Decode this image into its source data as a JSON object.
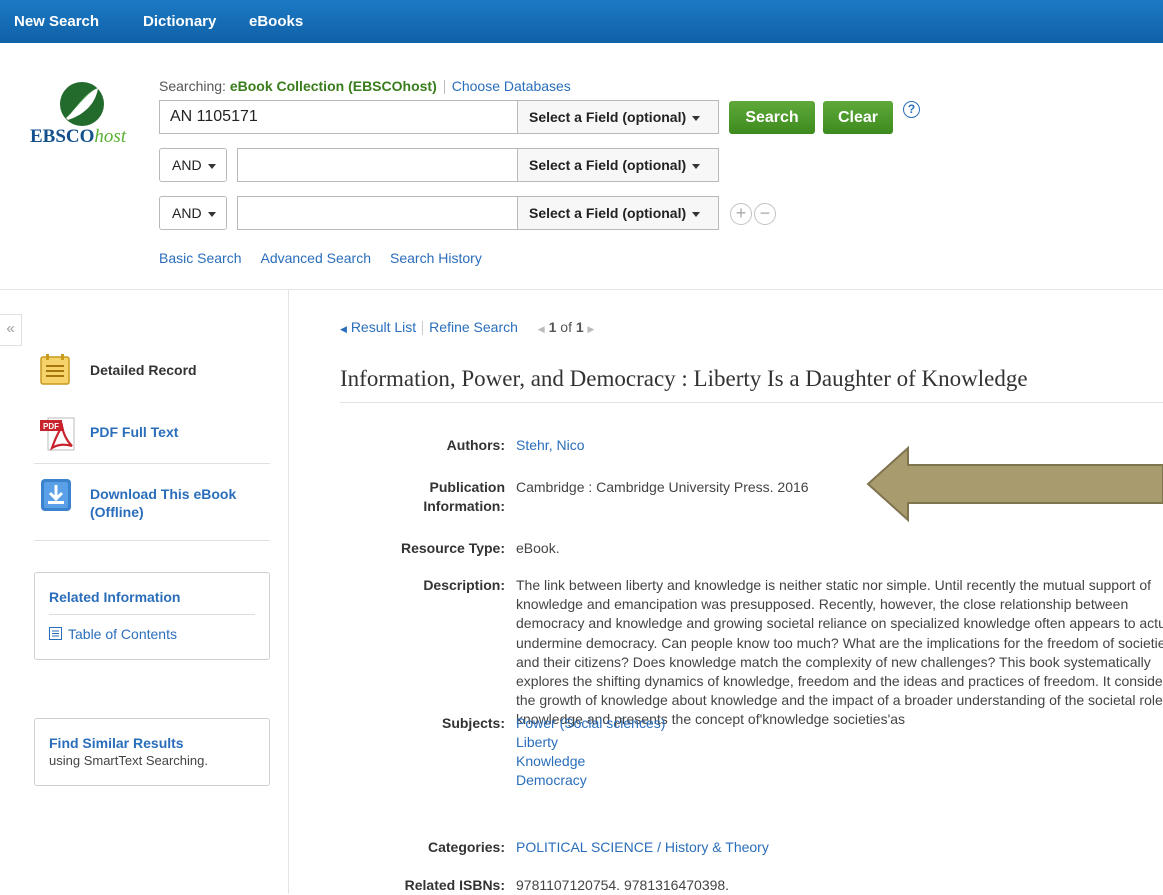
{
  "topnav": {
    "new_search": "New Search",
    "dictionary": "Dictionary",
    "ebooks": "eBooks"
  },
  "logo": {
    "brand": "EBSCO",
    "host": "host"
  },
  "searching": {
    "label": "Searching: ",
    "database": "eBook Collection (EBSCOhost)",
    "choose": "Choose Databases"
  },
  "search": {
    "row1_value": "AN 1105171",
    "field_label": "Select a Field (optional)",
    "bool_label": "AND",
    "search_button": "Search",
    "clear_button": "Clear",
    "help": "?",
    "plus": "+",
    "minus": "−"
  },
  "links": {
    "basic": "Basic Search",
    "advanced": "Advanced Search",
    "history": "Search History"
  },
  "sidebar": {
    "collapse": "«",
    "detailed": "Detailed Record",
    "pdf": "PDF Full Text",
    "pdf_badge": "PDF",
    "download": "Download This eBook (Offline)",
    "related_title": "Related Information",
    "toc": "Table of Contents",
    "similar_title": "Find Similar Results",
    "similar_sub": "using SmartText Searching."
  },
  "resultnav": {
    "result_list": "Result List",
    "refine": "Refine Search",
    "count_pre": "1",
    "count_mid": " of ",
    "count_post": "1"
  },
  "record": {
    "title": "Information, Power, and Democracy : Liberty Is a Daughter of Knowledge",
    "authors_label": "Authors:",
    "authors": "Stehr, Nico",
    "pub_label_1": "Publication",
    "pub_label_2": "Information:",
    "pub": "Cambridge : Cambridge University Press. 2016",
    "type_label": "Resource Type:",
    "type": "eBook.",
    "desc_label": "Description:",
    "desc": "The link between liberty and knowledge is neither static nor simple. Until recently the mutual support of knowledge and emancipation was presupposed. Recently, however, the close relationship between democracy and knowledge and growing societal reliance on specialized knowledge often appears to actually undermine democracy. Can people know too much? What are the implications for the freedom of societies and their citizens? Does knowledge match the complexity of new challenges? This book systematically explores the shifting dynamics of knowledge, freedom and the ideas and practices of freedom. It considers the growth of knowledge about knowledge and the impact of a broader understanding of the societal role of knowledge and presents the concept of'knowledge societies'as",
    "subjects_label": "Subjects:",
    "subjects": [
      "Power (Social sciences)",
      "Liberty",
      "Knowledge",
      "Democracy"
    ],
    "categories_label": "Categories:",
    "categories": "POLITICAL SCIENCE / History & Theory",
    "isbn_label": "Related ISBNs:",
    "isbn": "9781107120754. 9781316470398."
  },
  "colors": {
    "topbar": "#1467b3",
    "green": "#4a9a28",
    "link": "#2a6ebb",
    "arrow": "#a89c6e"
  }
}
